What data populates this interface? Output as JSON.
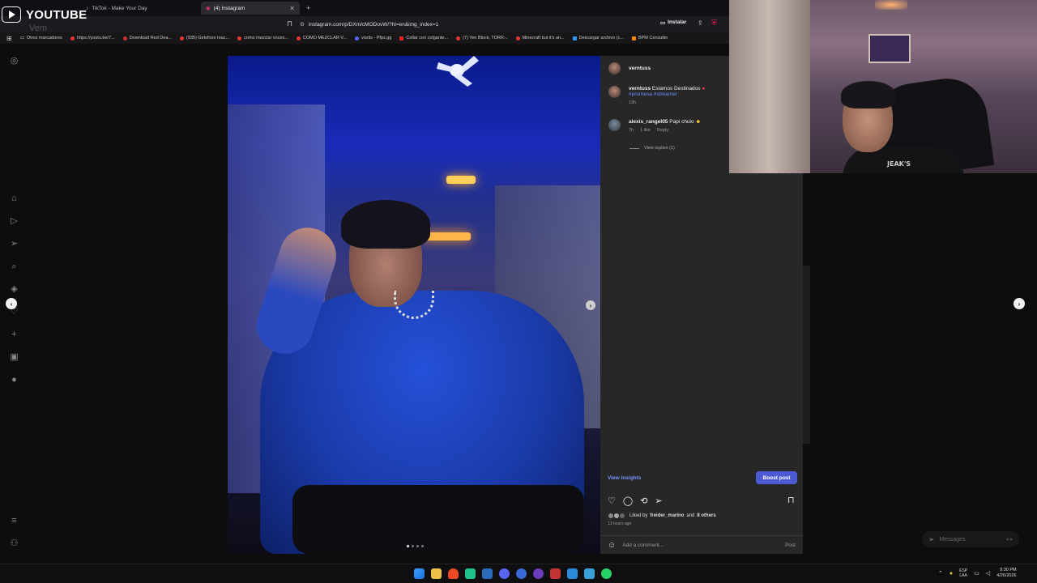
{
  "browser": {
    "tabs": [
      {
        "label": "",
        "active": false
      },
      {
        "label": "TikTok - Make Your Day",
        "active": false
      },
      {
        "label": "(4) Instagram",
        "active": true
      }
    ],
    "new_tab": "+",
    "url": "instagram.com/p/DXm/cMODovW/?hl=en&img_index=1",
    "install_label": "Instalar",
    "bookmarks": [
      "Otros marcadores",
      "https://youtu.be/7...",
      "Download Red Dea...",
      "(935) Girlofnox reac...",
      "como mezclar voces...",
      "COMO MEZCLAR V...",
      "voxlis - Pfps.gg",
      "Collar con colgante...",
      "(7) Yen Block, TORR...",
      "Minecraft but it's an...",
      "Descargar archivo (c...",
      "BPM Consultin"
    ]
  },
  "overlay": {
    "youtube_label": "YOUTUBE",
    "faint_text": "Vem"
  },
  "post": {
    "username": "verntuss",
    "caption": {
      "user": "verntuss",
      "text": "Estamos Destinados",
      "hashtags": "#promesa #streamer",
      "time": "13h"
    },
    "comment": {
      "user": "alexis_rangel05",
      "text": "Papi chulo",
      "time": "7h",
      "likes": "1 like",
      "reply": "Reply"
    },
    "view_replies": "View replies (1)",
    "view_insights": "View insights",
    "boost_post": "Boost post",
    "liked_by_prefix": "Liked by",
    "liked_by_user": "freider_marino",
    "liked_by_suffix": "and",
    "liked_by_others": "8 others",
    "time_ago": "13 hours ago",
    "add_comment_placeholder": "Add a comment...",
    "post_button": "Post"
  },
  "webcam": {
    "shirt_text": "JEAK'S"
  },
  "messages_label": "Messages",
  "taskbar": {
    "lang_top": "ESP",
    "lang_bottom": "LAA",
    "time": "9:30 PM",
    "date": "4/26/2026"
  },
  "colors": {
    "accent_blue": "#4c5bd4",
    "link_blue": "#7c93ff",
    "panel_bg": "#272727"
  }
}
